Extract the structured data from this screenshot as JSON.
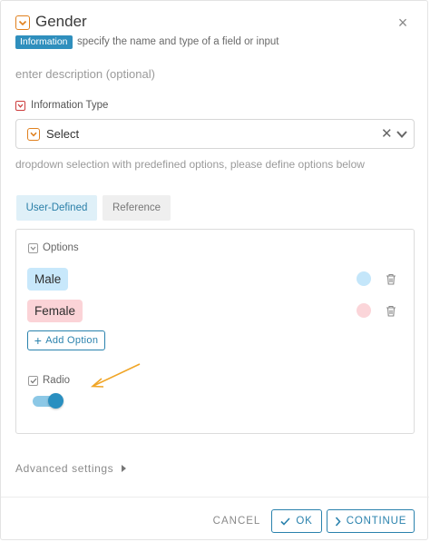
{
  "header": {
    "title": "Gender",
    "icon": "chevron-down-box-icon",
    "close_icon": "close-icon"
  },
  "info": {
    "badge": "Information",
    "text": "specify the name and type of a field or input"
  },
  "description": {
    "placeholder": "enter description (optional)",
    "value": ""
  },
  "info_type": {
    "label": "Information Type",
    "selected": "Select",
    "hint": "dropdown selection with predefined options, please define options below"
  },
  "tabs": [
    {
      "label": "User-Defined",
      "active": true
    },
    {
      "label": "Reference",
      "active": false
    }
  ],
  "options_section": {
    "label": "Options",
    "items": [
      {
        "label": "Male",
        "chip_color": "#c8e8fb",
        "dot_color": "#c4e6fa"
      },
      {
        "label": "Female",
        "chip_color": "#fbd3d7",
        "dot_color": "#fbd5d9"
      }
    ],
    "add_label": "Add Option"
  },
  "radio": {
    "label": "Radio",
    "enabled": true
  },
  "advanced": {
    "label": "Advanced settings"
  },
  "footer": {
    "cancel": "CANCEL",
    "ok": "OK",
    "continue": "CONTINUE"
  },
  "colors": {
    "accent": "#2a82ad",
    "badge": "#2f8fbd",
    "orange": "#e0801e",
    "red": "#cc3c3c",
    "annotation_arrow": "#f0a526"
  }
}
